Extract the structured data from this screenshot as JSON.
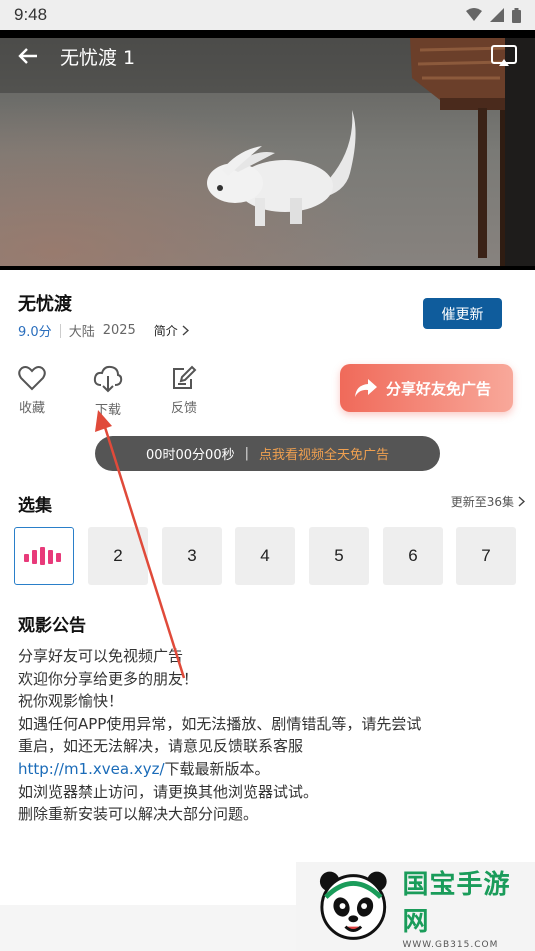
{
  "status_bar": {
    "time": "9:48",
    "icons": [
      "wifi-icon",
      "signal-icon",
      "battery-icon"
    ]
  },
  "video": {
    "title": "无忧渡 1",
    "back_icon": "back-arrow-icon",
    "cast_icon": "cast-icon"
  },
  "info": {
    "title": "无忧渡",
    "score": "9.0分",
    "region": "大陆",
    "year": "2025",
    "intro_label": "简介",
    "urge_update_label": "催更新"
  },
  "actions": [
    {
      "icon": "heart-icon",
      "label": "收藏"
    },
    {
      "icon": "download-icon",
      "label": "下载"
    },
    {
      "icon": "feedback-icon",
      "label": "反馈"
    }
  ],
  "share_ad": {
    "icon": "share-arrow-icon",
    "label": "分享好友免广告"
  },
  "timer": {
    "time": "00时00分00秒",
    "separator": "|",
    "link": "点我看视频全天免广告"
  },
  "episodes": {
    "title": "选集",
    "update_label": "更新至36集",
    "items": [
      "2",
      "3",
      "4",
      "5",
      "6",
      "7"
    ],
    "playing_icon": "playing-bars-icon"
  },
  "notice": {
    "title": "观影公告",
    "lines": [
      "分享好友可以免视频广告",
      "欢迎你分享给更多的朋友！",
      "祝你观影愉快！",
      "如遇任何APP使用异常，如无法播放、剧情错乱等，请先尝试",
      "重启，如还无法解决，请意见反馈联系客服"
    ],
    "link": "http://m1.xvea.xyz/",
    "link_suffix": "下载最新版本。",
    "lines_after": [
      "如浏览器禁止访问，请更换其他浏览器试试。",
      "删除重新安装可以解决大部分问题。"
    ]
  },
  "watermark": {
    "brand": "国宝手游网",
    "url": "WWW.GB315.COM"
  },
  "colors": {
    "accent_blue": "#0f5c9c",
    "link_blue": "#1a6bb8",
    "score_blue": "#2a6ebd",
    "share_red": "#f06a5a",
    "timer_orange": "#f0a050",
    "annotation_red": "#e04a3a"
  }
}
